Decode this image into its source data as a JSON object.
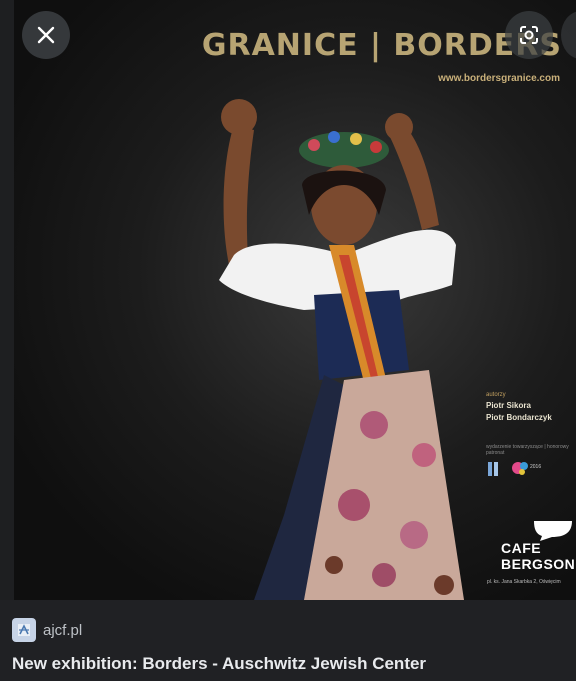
{
  "viewer": {
    "close_label": "close",
    "lens_label": "search image"
  },
  "poster": {
    "title": "GRANICE | BORDERS",
    "url": "www.bordersgranice.com",
    "authors_label": "autorzy",
    "authors": [
      "Piotr Sikora",
      "Piotr Bondarczyk"
    ],
    "partners_label": "wydarzenie towarzyszące | honorowy patronat",
    "logo_year": "2016",
    "cafe_line1": "CAFE",
    "cafe_line2": "BERGSON",
    "cafe_address": "pl. ks. Jana Skarbka 2, Oświęcim"
  },
  "caption": {
    "source": "ajcf.pl",
    "title": "New exhibition: Borders - Auschwitz Jewish Center"
  },
  "icons": {
    "close": "close-icon",
    "lens": "google-lens-icon",
    "favicon": "site-favicon-icon"
  }
}
